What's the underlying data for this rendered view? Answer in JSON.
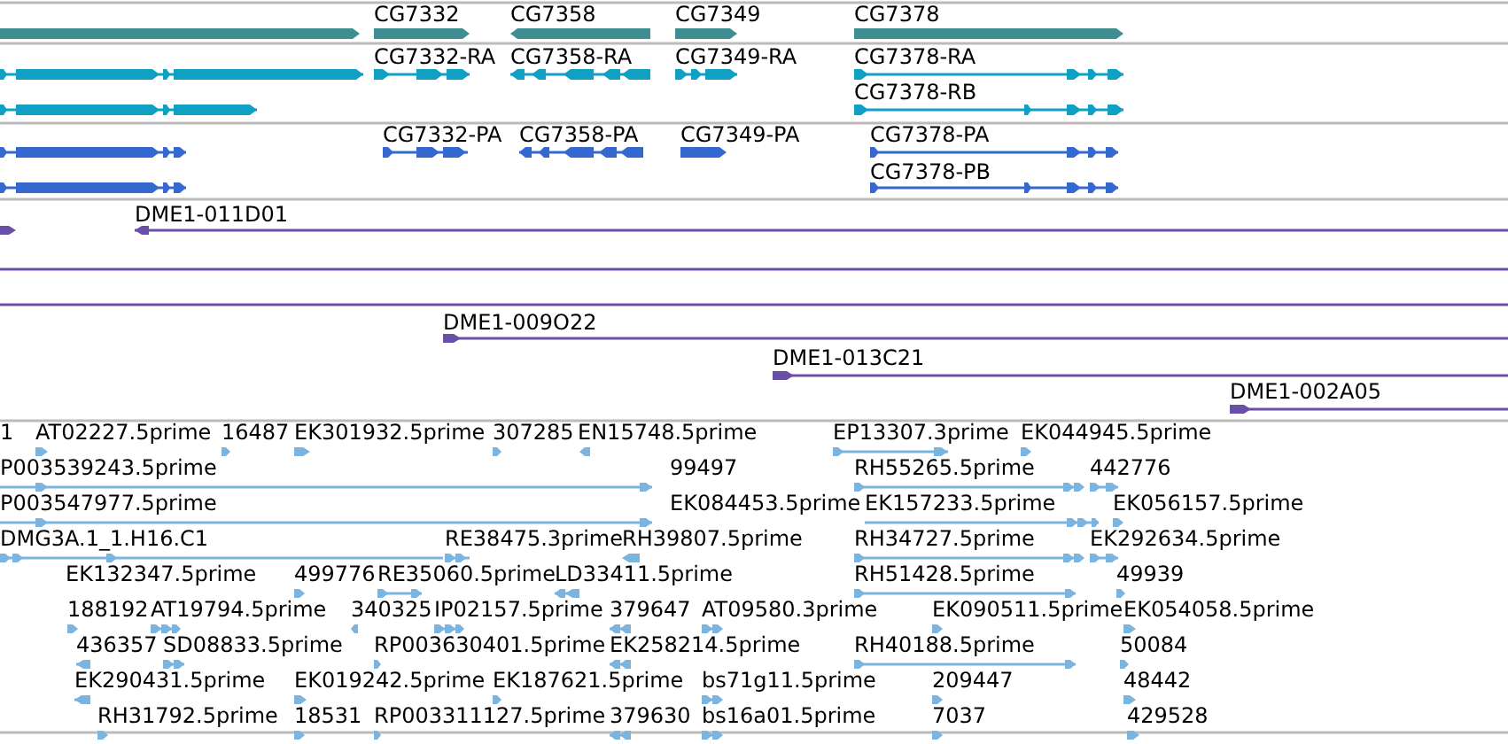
{
  "tracks": [
    {
      "kind": "gene",
      "lanes": [
        {
          "features": [
            {
              "reverse": false
            },
            {
              "label": "CG7332",
              "reverse": false
            },
            {
              "label": "CG7358",
              "reverse": true
            },
            {
              "label": "CG7349",
              "reverse": false
            },
            {
              "label": "CG7378",
              "reverse": false
            }
          ]
        }
      ]
    },
    {
      "kind": "transcript",
      "lanes": [
        {
          "features": [
            {
              "reverse": false
            },
            {
              "label": "CG7332-RA",
              "reverse": false
            },
            {
              "label": "CG7358-RA",
              "reverse": true
            },
            {
              "label": "CG7349-RA",
              "reverse": false
            },
            {
              "label": "CG7378-RA",
              "reverse": false
            }
          ]
        },
        {
          "features": [
            {
              "reverse": false
            },
            {
              "label": "CG7378-RB",
              "reverse": false
            }
          ]
        }
      ]
    },
    {
      "kind": "protein",
      "lanes": [
        {
          "features": [
            {
              "reverse": false
            },
            {
              "label": "CG7332-PA",
              "reverse": false
            },
            {
              "label": "CG7358-PA",
              "reverse": true
            },
            {
              "label": "CG7349-PA",
              "reverse": false
            },
            {
              "label": "CG7378-PA",
              "reverse": false
            }
          ]
        },
        {
          "features": [
            {
              "reverse": false
            },
            {
              "label": "CG7378-PB",
              "reverse": false
            }
          ]
        }
      ]
    },
    {
      "kind": "clone",
      "lanes": [
        {
          "features": [
            {
              "kind": "arrow",
              "reverse": false
            },
            {
              "kind": "arrow",
              "label": "DME1-011D01",
              "reverse": true
            }
          ]
        },
        {
          "features": [
            {
              "kind": "line"
            }
          ]
        },
        {
          "features": [
            {
              "kind": "line"
            }
          ]
        },
        {
          "features": [
            {
              "kind": "arrow",
              "label": "DME1-009O22",
              "reverse": false
            }
          ]
        },
        {
          "features": [
            {
              "kind": "arrow",
              "label": "DME1-013C21",
              "reverse": false
            }
          ]
        },
        {
          "features": [
            {
              "kind": "arrow",
              "label": "DME1-002A05",
              "reverse": false
            }
          ]
        }
      ]
    },
    {
      "kind": "est",
      "lanes": [
        {
          "features": [
            {
              "label": "1"
            },
            {
              "label": "AT02227.5prime",
              "reverse": false
            },
            {
              "label": "16487",
              "reverse": false
            },
            {
              "label": "EK301932.5prime",
              "reverse": false
            },
            {
              "label": "307285",
              "reverse": false
            },
            {
              "label": "EN15748.5prime",
              "reverse": true
            },
            {
              "label": "EP13307.3prime",
              "reverse": false
            },
            {
              "label": "EK044945.5prime",
              "reverse": false
            }
          ]
        },
        {
          "features": [
            {
              "label": "P003539243.5prime",
              "reverse": false
            },
            {
              "label": "99497"
            },
            {
              "label": "RH55265.5prime",
              "reverse": false
            },
            {
              "label": "442776",
              "reverse": false
            }
          ]
        },
        {
          "features": [
            {
              "label": "P003547977.5prime",
              "reverse": false
            },
            {
              "label": "EK084453.5prime"
            },
            {
              "label": "EK157233.5prime",
              "reverse": false
            },
            {
              "label": "EK056157.5prime",
              "reverse": false
            }
          ]
        },
        {
          "features": [
            {
              "label": "DMG3A.1_1.H16.C1",
              "reverse": false
            },
            {
              "label": "RE38475.3prime",
              "reverse": false
            },
            {
              "label": "RH39807.5prime",
              "reverse": true
            },
            {
              "label": "RH34727.5prime",
              "reverse": false
            },
            {
              "label": "EK292634.5prime",
              "reverse": false
            }
          ]
        },
        {
          "features": [
            {
              "label": "EK132347.5prime"
            },
            {
              "label": "499776",
              "reverse": false
            },
            {
              "label": "RE35060.5prime",
              "reverse": false
            },
            {
              "label": "LD33411.5prime",
              "reverse": true
            },
            {
              "label": "RH51428.5prime",
              "reverse": false
            },
            {
              "label": "49939",
              "reverse": false
            }
          ]
        },
        {
          "features": [
            {
              "label": "188192",
              "reverse": false
            },
            {
              "label": "AT19794.5prime",
              "reverse": false
            },
            {
              "label": "340325",
              "reverse": true
            },
            {
              "label": "IP02157.5prime",
              "reverse": false
            },
            {
              "label": "379647",
              "reverse": true
            },
            {
              "label": "AT09580.3prime",
              "reverse": false
            },
            {
              "label": "EK090511.5prime",
              "reverse": false
            },
            {
              "label": "EK054058.5prime",
              "reverse": false
            }
          ]
        },
        {
          "features": [
            {
              "label": "436357",
              "reverse": true
            },
            {
              "label": "SD08833.5prime",
              "reverse": false
            },
            {
              "label": "RP003630401.5prime",
              "reverse": false
            },
            {
              "label": "EK258214.5prime",
              "reverse": true
            },
            {
              "label": "RH40188.5prime",
              "reverse": false
            },
            {
              "label": "50084",
              "reverse": false
            }
          ]
        },
        {
          "features": [
            {
              "label": "EK290431.5prime",
              "reverse": true
            },
            {
              "label": "EK019242.5prime",
              "reverse": false
            },
            {
              "label": "EK187621.5prime",
              "reverse": false
            },
            {
              "label": "bs71g11.5prime",
              "reverse": false
            },
            {
              "label": "209447",
              "reverse": false
            },
            {
              "label": "48442",
              "reverse": false
            }
          ]
        },
        {
          "features": [
            {
              "label": "RH31792.5prime",
              "reverse": false
            },
            {
              "label": "18531",
              "reverse": false
            },
            {
              "label": "RP003311127.5prime",
              "reverse": false
            },
            {
              "label": "379630",
              "reverse": true
            },
            {
              "label": "bs16a01.5prime",
              "reverse": false
            },
            {
              "label": "7037",
              "reverse": false
            },
            {
              "label": "429528",
              "reverse": false
            }
          ]
        }
      ]
    }
  ]
}
